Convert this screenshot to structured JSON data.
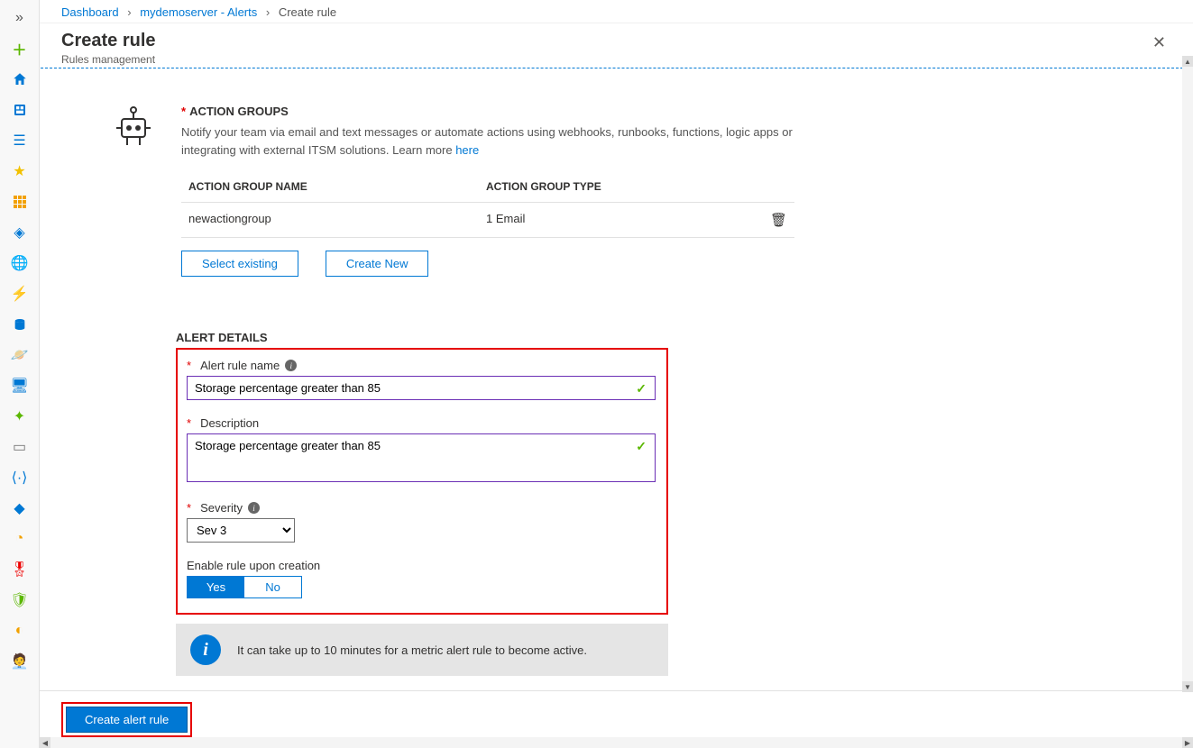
{
  "breadcrumb": {
    "items": [
      "Dashboard",
      "mydemoserver - Alerts",
      "Create rule"
    ]
  },
  "header": {
    "title": "Create rule",
    "subtitle": "Rules management"
  },
  "actionGroups": {
    "title": "ACTION GROUPS",
    "desc_pre": "Notify your team via email and text messages or automate actions using webhooks, runbooks, functions, logic apps or integrating with external ITSM solutions. Learn more ",
    "desc_link": "here",
    "col_name": "ACTION GROUP NAME",
    "col_type": "ACTION GROUP TYPE",
    "row": {
      "name": "newactiongroup",
      "type": "1 Email"
    },
    "btn_select": "Select existing",
    "btn_create": "Create New"
  },
  "alertDetails": {
    "heading": "ALERT DETAILS",
    "name_label": "Alert rule name",
    "name_value": "Storage percentage greater than 85",
    "desc_label": "Description",
    "desc_value": "Storage percentage greater than 85",
    "sev_label": "Severity",
    "sev_value": "Sev 3",
    "enable_label": "Enable rule upon creation",
    "toggle_yes": "Yes",
    "toggle_no": "No"
  },
  "infoBanner": {
    "text": "It can take up to 10 minutes for a metric alert rule to become active."
  },
  "footer": {
    "create_label": "Create alert rule"
  }
}
